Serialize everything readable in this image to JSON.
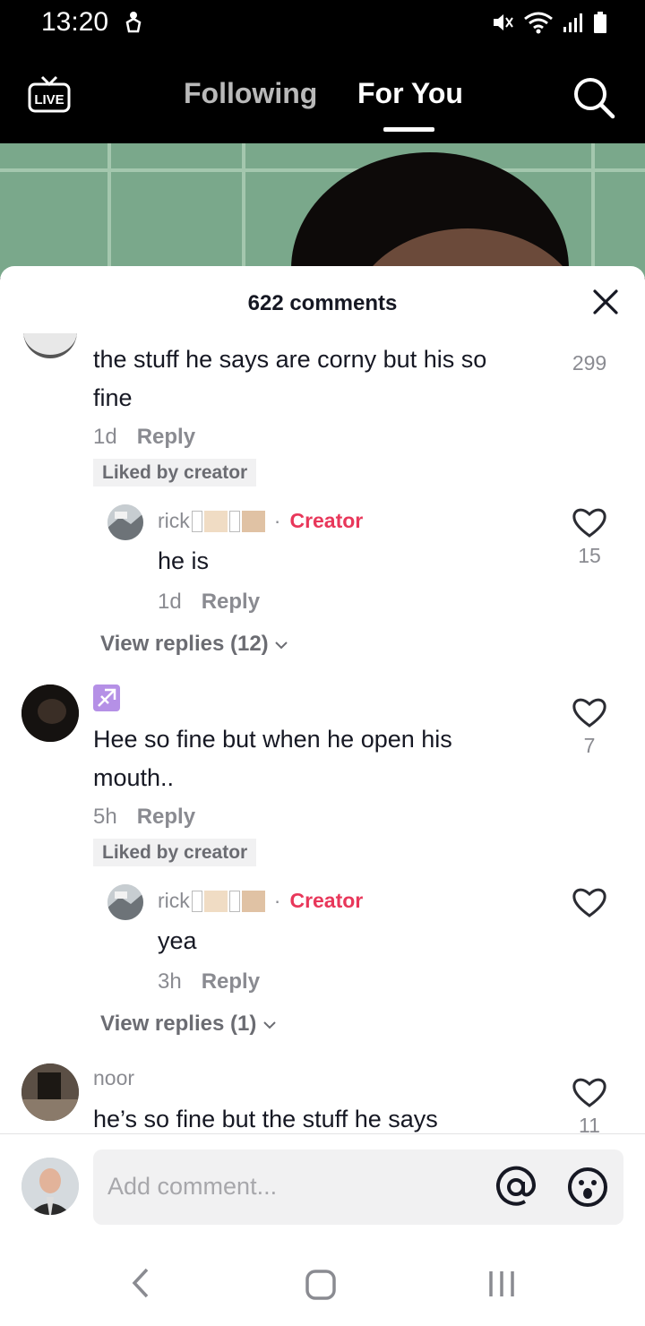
{
  "status": {
    "time": "13:20"
  },
  "nav": {
    "live_label": "LIVE",
    "following": "Following",
    "for_you": "For You"
  },
  "sheet": {
    "title": "622 comments"
  },
  "comments": [
    {
      "text_line1": "the stuff he says are corny but his so",
      "text_line2": "fine",
      "age": "1d",
      "reply_label": "Reply",
      "liked_badge": "Liked by creator",
      "likes": "299",
      "reply": {
        "username": "rick",
        "creator_label": "Creator",
        "dot": "·",
        "text": "he is",
        "age": "1d",
        "reply_label": "Reply",
        "likes": "15"
      },
      "view_replies": "View replies (12)"
    },
    {
      "badge_icon": "sagittarius-icon",
      "text_line1": "Hee so fine but when he open his",
      "text_line2": "mouth..",
      "age": "5h",
      "reply_label": "Reply",
      "liked_badge": "Liked by creator",
      "likes": "7",
      "reply": {
        "username": "rick",
        "creator_label": "Creator",
        "dot": "·",
        "text": "yea",
        "age": "3h",
        "reply_label": "Reply",
        "likes": ""
      },
      "view_replies": "View replies (1)"
    },
    {
      "username": "noor",
      "text_line1": "he’s so fine but the stuff he says",
      "likes": "11"
    }
  ],
  "composer": {
    "placeholder": "Add comment..."
  },
  "colors": {
    "creator": "#e8375a",
    "text": "#161823",
    "muted": "#8a8b91"
  }
}
